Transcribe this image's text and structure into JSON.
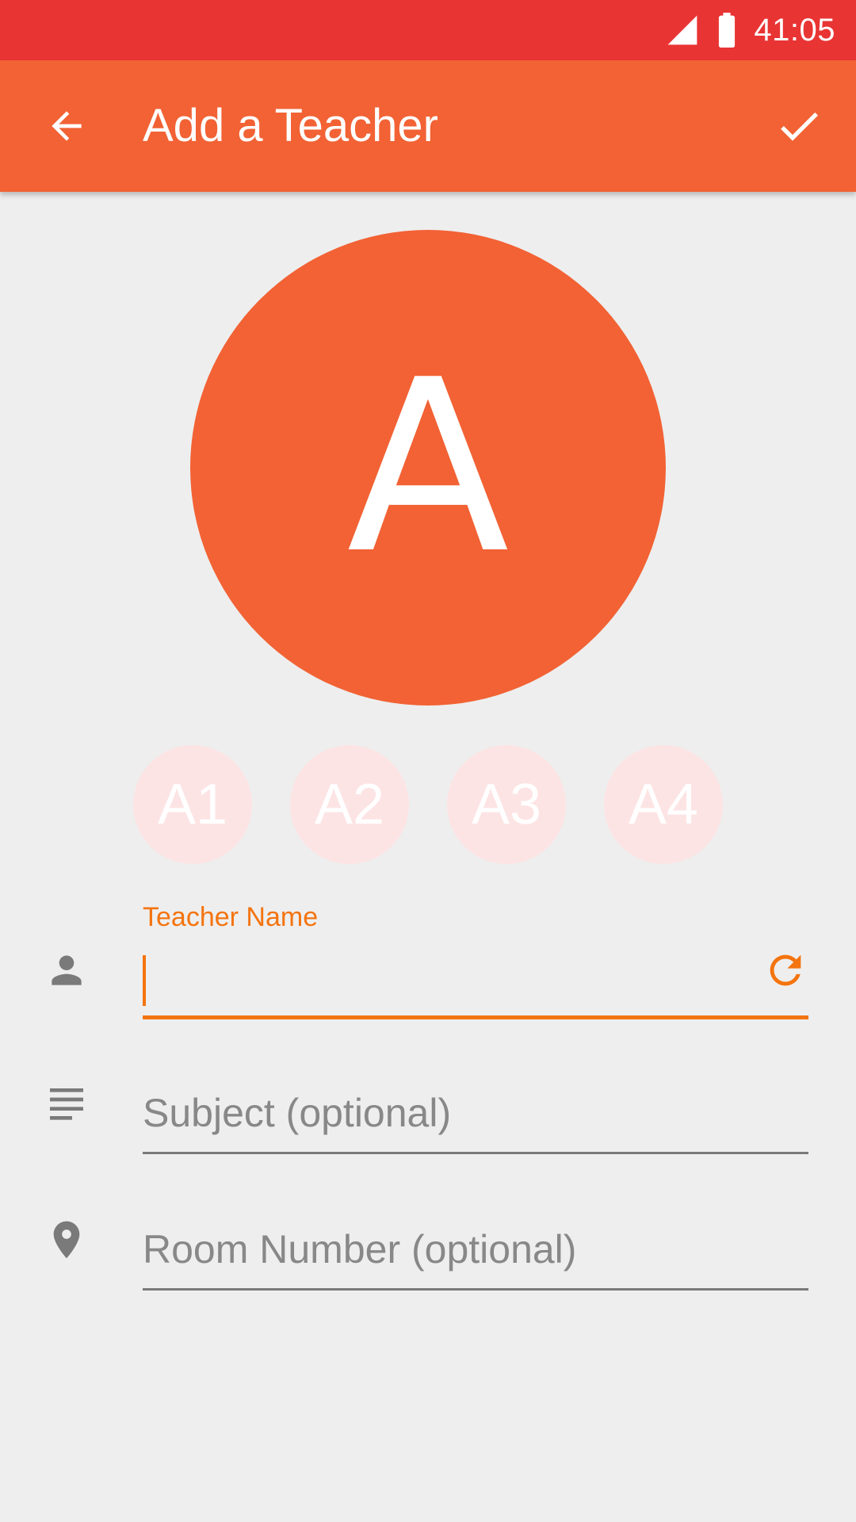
{
  "status_bar": {
    "time": "41:05",
    "icons": [
      "signal-icon",
      "battery-icon"
    ]
  },
  "app_bar": {
    "title": "Add a Teacher",
    "back_icon": "arrow-back-icon",
    "confirm_icon": "check-icon",
    "color": "#f26234"
  },
  "avatar": {
    "letter": "A",
    "color": "#f26234"
  },
  "chips": [
    {
      "label": "A1"
    },
    {
      "label": "A2"
    },
    {
      "label": "A3"
    },
    {
      "label": "A4"
    }
  ],
  "form": {
    "name": {
      "label": "Teacher Name",
      "value": "",
      "icon": "person-icon",
      "action_icon": "refresh-icon"
    },
    "subject": {
      "placeholder": "Subject (optional)",
      "value": "",
      "icon": "subject-lines-icon"
    },
    "room": {
      "placeholder": "Room Number (optional)",
      "value": "",
      "icon": "location-pin-icon"
    }
  },
  "colors": {
    "status_bar": "#e93434",
    "accent": "#f4740f",
    "chip_bg": "#fde4e4",
    "background": "#eeeeee"
  }
}
